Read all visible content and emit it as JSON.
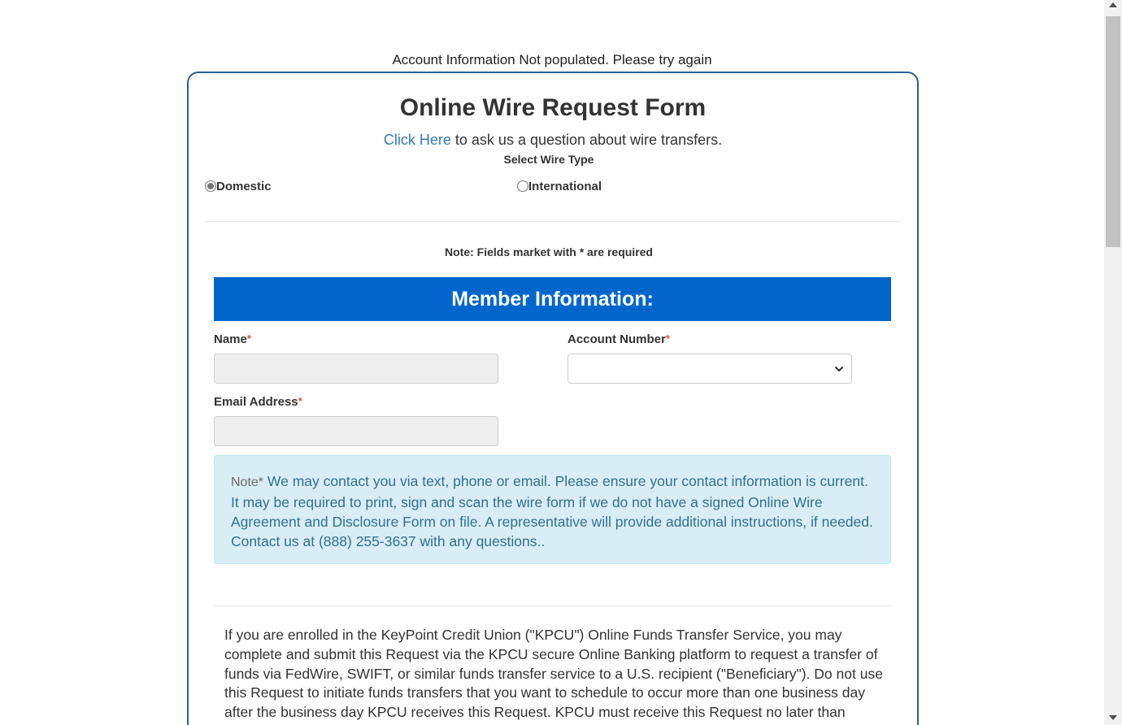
{
  "status_message": "Account Information Not populated. Please try again",
  "form": {
    "title": "Online Wire Request Form",
    "help_link": "Click Here",
    "help_text": " to ask us a question about wire transfers.",
    "wire_type_label": "Select Wire Type",
    "wire_types": [
      {
        "label": "Domestic",
        "selected": true
      },
      {
        "label": "International",
        "selected": false
      }
    ],
    "required_note": "Note: Fields market with * are required"
  },
  "member_section": {
    "title": "Member Information:",
    "name_label": "Name",
    "name_value": "",
    "account_label": "Account Number",
    "account_value": "",
    "email_label": "Email Address",
    "email_value": "",
    "required_marker": "*"
  },
  "info_alert": {
    "prefix": "Note*",
    "text": " We may contact you via text, phone or email. Please ensure your contact information is current. It may be required to print, sign and scan the wire form if we do not have a signed Online Wire Agreement and Disclosure Form on file. A representative will provide additional instructions, if needed. Contact us at (888) 255-3637 with any questions.."
  },
  "disclosure_text": "If you are enrolled in the KeyPoint Credit Union (\"KPCU\") Online Funds Transfer Service, you may complete and submit this Request via the KPCU secure Online Banking platform to request a transfer of funds via FedWire, SWIFT, or similar funds transfer service to a U.S. recipient (\"Beneficiary\"). Do not use this Request to initiate funds transfers that you want to schedule to occur more than one business day after the business day KPCU receives this Request. KPCU must receive this Request no later than",
  "colors": {
    "card_border": "#2a5d96",
    "banner_bg": "#0066cc",
    "link": "#337ab7",
    "alert_bg": "#d9edf7",
    "alert_text": "#31708f",
    "required": "#d9534f"
  }
}
